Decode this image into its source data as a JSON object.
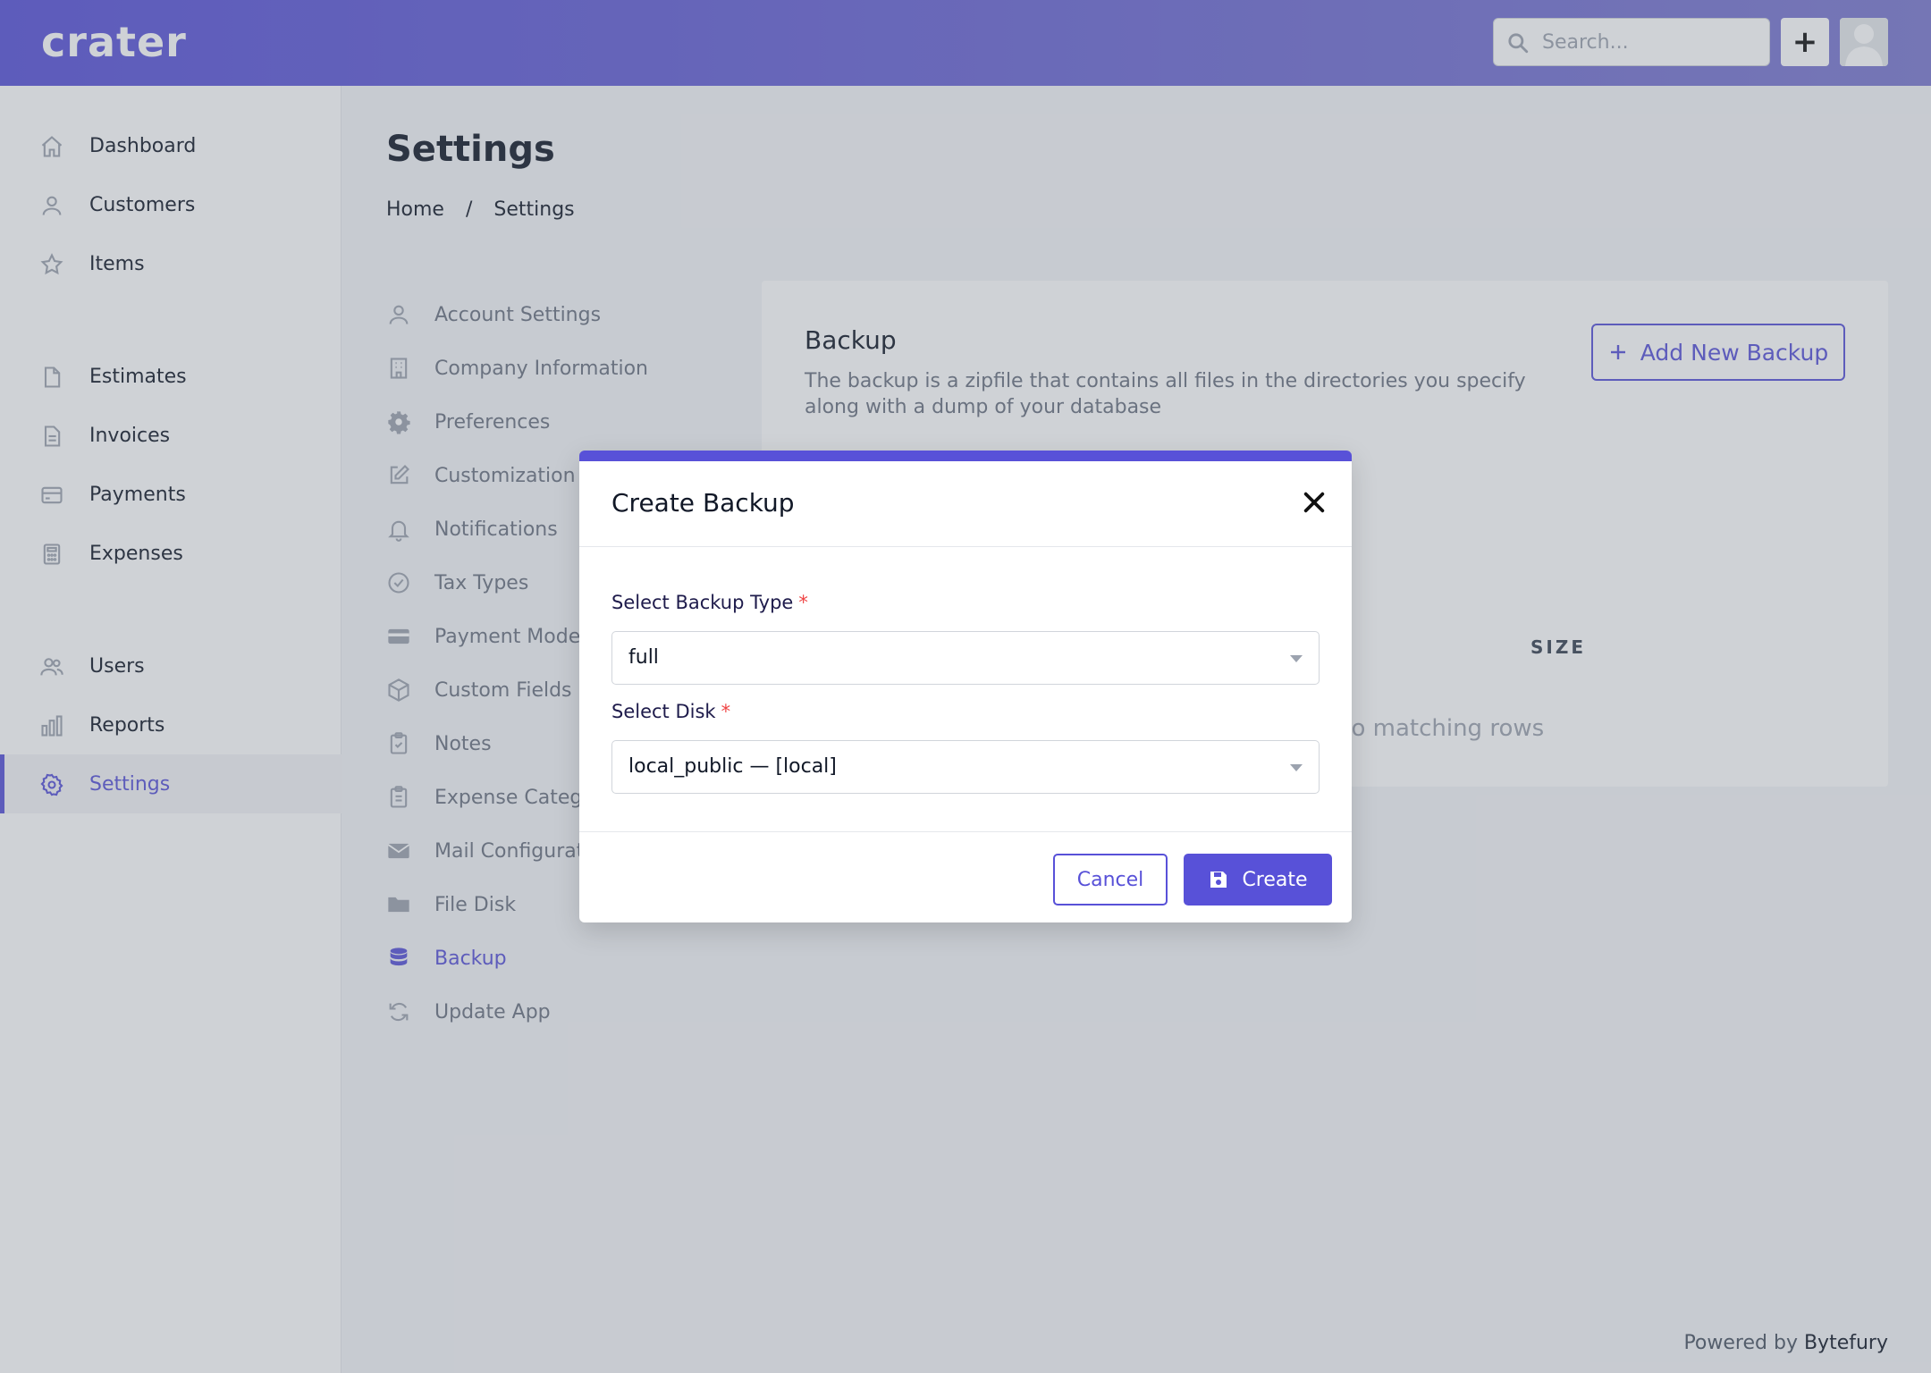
{
  "header": {
    "logo": "crater",
    "search_placeholder": "Search...",
    "add_label": "+"
  },
  "sidebar": {
    "items": [
      {
        "label": "Dashboard",
        "icon": "home-icon"
      },
      {
        "label": "Customers",
        "icon": "user-icon"
      },
      {
        "label": "Items",
        "icon": "star-icon"
      },
      {
        "label": "Estimates",
        "icon": "document-icon"
      },
      {
        "label": "Invoices",
        "icon": "document-text-icon"
      },
      {
        "label": "Payments",
        "icon": "credit-card-icon"
      },
      {
        "label": "Expenses",
        "icon": "calculator-icon"
      },
      {
        "label": "Users",
        "icon": "users-icon"
      },
      {
        "label": "Reports",
        "icon": "chart-bar-icon"
      },
      {
        "label": "Settings",
        "icon": "cog-icon",
        "active": true
      }
    ]
  },
  "page": {
    "title": "Settings",
    "breadcrumb": [
      "Home",
      "/",
      "Settings"
    ]
  },
  "settings_nav": {
    "items": [
      {
        "label": "Account Settings",
        "icon": "user-icon"
      },
      {
        "label": "Company Information",
        "icon": "office-building-icon"
      },
      {
        "label": "Preferences",
        "icon": "cog-icon"
      },
      {
        "label": "Customization",
        "icon": "pencil-alt-icon"
      },
      {
        "label": "Notifications",
        "icon": "bell-icon"
      },
      {
        "label": "Tax Types",
        "icon": "check-circle-icon"
      },
      {
        "label": "Payment Modes",
        "icon": "credit-card-icon"
      },
      {
        "label": "Custom Fields",
        "icon": "cube-icon"
      },
      {
        "label": "Notes",
        "icon": "clipboard-check-icon"
      },
      {
        "label": "Expense Categories",
        "icon": "clipboard-list-icon"
      },
      {
        "label": "Mail Configuration",
        "icon": "mail-icon"
      },
      {
        "label": "File Disk",
        "icon": "folder-icon"
      },
      {
        "label": "Backup",
        "icon": "database-icon",
        "active": true
      },
      {
        "label": "Update App",
        "icon": "refresh-icon"
      }
    ]
  },
  "backup_card": {
    "title": "Backup",
    "description": "The backup is a zipfile that contains all files in the directories you specify along with a dump of your database",
    "add_button": "Add New Backup",
    "column_size": "SIZE",
    "empty_text": "No matching rows"
  },
  "modal": {
    "title": "Create Backup",
    "backup_type_label": "Select Backup Type",
    "backup_type_value": "full",
    "disk_label": "Select Disk",
    "disk_value": "local_public — [local]",
    "required_mark": "*",
    "cancel": "Cancel",
    "create": "Create"
  },
  "footer": {
    "prefix": "Powered by",
    "brand": "Bytefury"
  },
  "colors": {
    "accent": "#5851d8",
    "required": "#ef4444"
  }
}
